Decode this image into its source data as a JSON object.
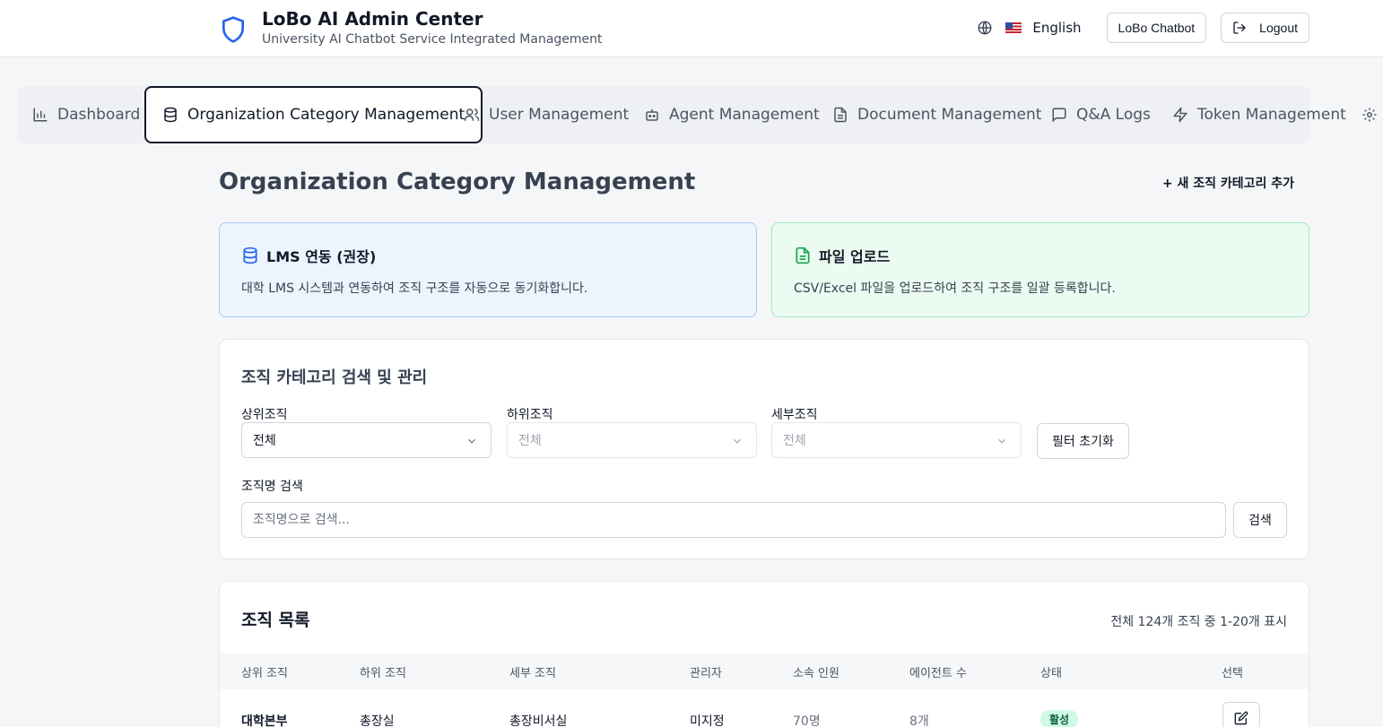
{
  "header": {
    "title": "LoBo AI Admin Center",
    "subtitle": "University AI Chatbot Service Integrated Management",
    "language": "English",
    "chatbot_button": "LoBo Chatbot",
    "logout_button": "Logout"
  },
  "tabs": [
    {
      "label": "Dashboard",
      "icon": "bar-chart-icon"
    },
    {
      "label": "Organization Category Management",
      "icon": "database-icon",
      "active": true
    },
    {
      "label": "User Management",
      "icon": "users-icon"
    },
    {
      "label": "Agent Management",
      "icon": "bot-icon"
    },
    {
      "label": "Document Management",
      "icon": "file-text-icon"
    },
    {
      "label": "Q&A Logs",
      "icon": "message-square-icon"
    },
    {
      "label": "Token Management",
      "icon": "zap-icon"
    }
  ],
  "page": {
    "title": "Organization Category Management",
    "add_button": "+ 새 조직 카테고리 추가"
  },
  "cards": {
    "lms": {
      "title": "LMS 연동 (권장)",
      "desc": "대학 LMS 시스템과 연동하여 조직 구조를 자동으로 동기화합니다."
    },
    "upload": {
      "title": "파일 업로드",
      "desc": "CSV/Excel 파일을 업로드하여 조직 구조를 일괄 등록합니다."
    }
  },
  "search_panel": {
    "title": "조직 카테고리 검색 및 관리",
    "parent_label": "상위조직",
    "parent_value": "전체",
    "child_label": "하위조직",
    "child_value": "전체",
    "detail_label": "세부조직",
    "detail_value": "전체",
    "reset_button": "필터 초기화",
    "name_label": "조직명 검색",
    "name_placeholder": "조직명으로 검색...",
    "search_button": "검색"
  },
  "list": {
    "title": "조직 목록",
    "count_text": "전체 124개 조직 중 1-20개 표시",
    "columns": [
      "상위 조직",
      "하위 조직",
      "세부 조직",
      "관리자",
      "소속 인원",
      "에이전트 수",
      "상태",
      "선택"
    ],
    "rows": [
      {
        "parent": "대학본부",
        "child": "총장실",
        "detail": "총장비서실",
        "manager": "미지정",
        "members": "70명",
        "agents": "8개",
        "status": "활성"
      }
    ]
  },
  "colors": {
    "accent_blue": "#2563eb",
    "accent_green": "#16a34a",
    "active_badge_bg": "#d1fae5"
  }
}
